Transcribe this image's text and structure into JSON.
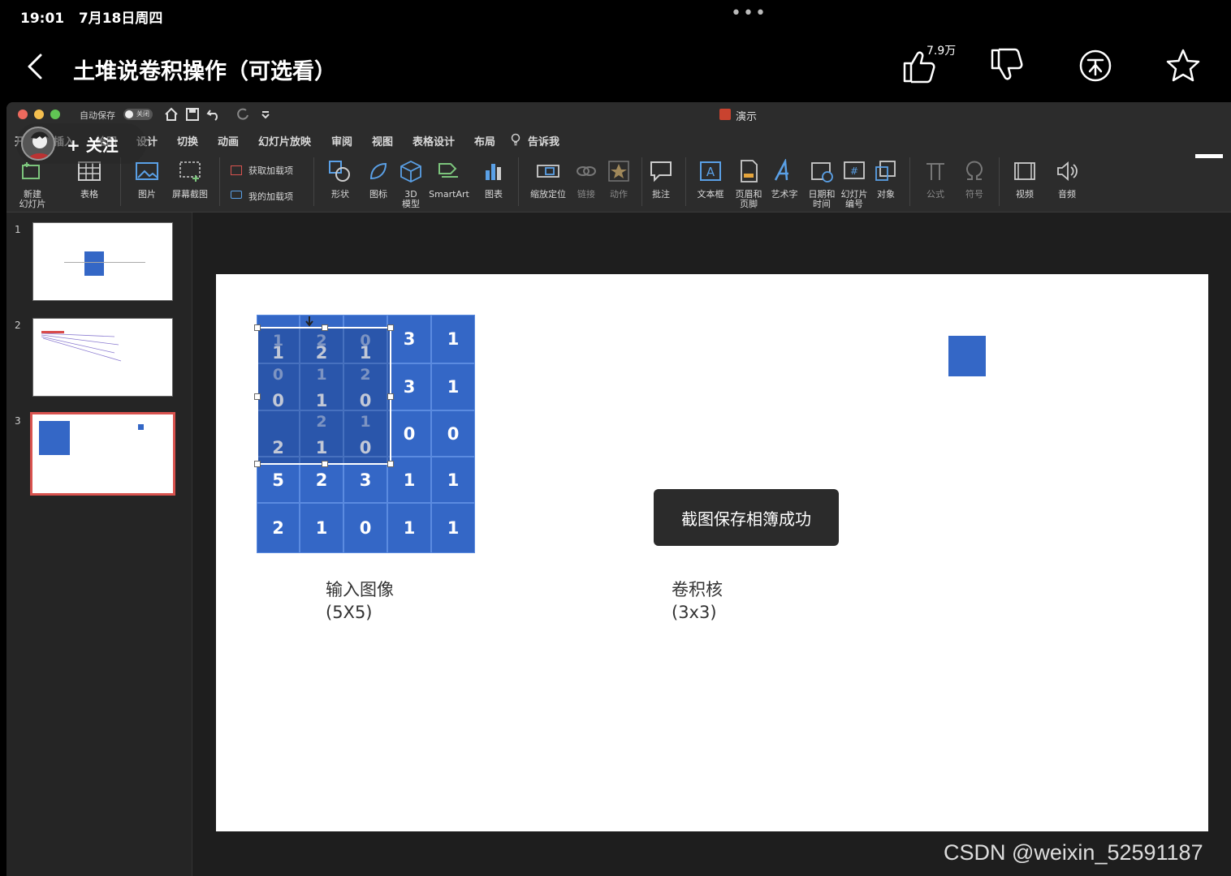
{
  "status_bar": {
    "time": "19:01",
    "date": "7月18日周四"
  },
  "video": {
    "title": "土堆说卷积操作（可选看）",
    "like_count": "7.9万"
  },
  "follow": {
    "label": "关注"
  },
  "ppt": {
    "autosave_label": "自动保存",
    "autosave_state": "关闭",
    "document_name": "演示",
    "tabs": [
      "开始",
      "插入",
      "绘图",
      "设计",
      "切换",
      "动画",
      "幻灯片放映",
      "审阅",
      "视图",
      "表格设计",
      "布局",
      "告诉我"
    ],
    "ribbon": {
      "new_slide": "新建\n幻灯片",
      "table": "表格",
      "picture": "图片",
      "screenshot": "屏幕截图",
      "get_addins": "获取加载项",
      "my_addins": "我的加载项",
      "shapes": "形状",
      "icons": "图标",
      "model3d": "3D\n模型",
      "smartart": "SmartArt",
      "chart": "图表",
      "zoom": "缩放定位",
      "link": "链接",
      "action": "动作",
      "comment": "批注",
      "textbox": "文本框",
      "header_footer": "页眉和\n页脚",
      "wordart": "艺术字",
      "datetime": "日期和\n时间",
      "slide_number": "幻灯片\n编号",
      "object": "对象",
      "equation": "公式",
      "symbol": "符号",
      "video": "视频",
      "audio": "音频"
    },
    "slides": [
      "1",
      "2",
      "3"
    ]
  },
  "slide": {
    "input_grid": [
      [
        "1",
        "2",
        "1",
        "3",
        "1"
      ],
      [
        "0",
        "1",
        "0",
        "3",
        "1"
      ],
      [
        "2",
        "1",
        "0",
        "0",
        "0"
      ],
      [
        "5",
        "2",
        "3",
        "1",
        "1"
      ],
      [
        "2",
        "1",
        "0",
        "1",
        "1"
      ]
    ],
    "kernel_ghost": [
      [
        "1",
        "2",
        "0"
      ],
      [
        "0",
        "1",
        "2"
      ],
      [
        "",
        "2",
        "1"
      ]
    ],
    "input_caption": "输入图像",
    "input_size": "(5X5)",
    "kernel_caption": "卷积核",
    "kernel_size": "(3x3)",
    "accent_color": "#3467c6"
  },
  "toast": "截图保存相簿成功",
  "watermark": "CSDN @weixin_52591187"
}
